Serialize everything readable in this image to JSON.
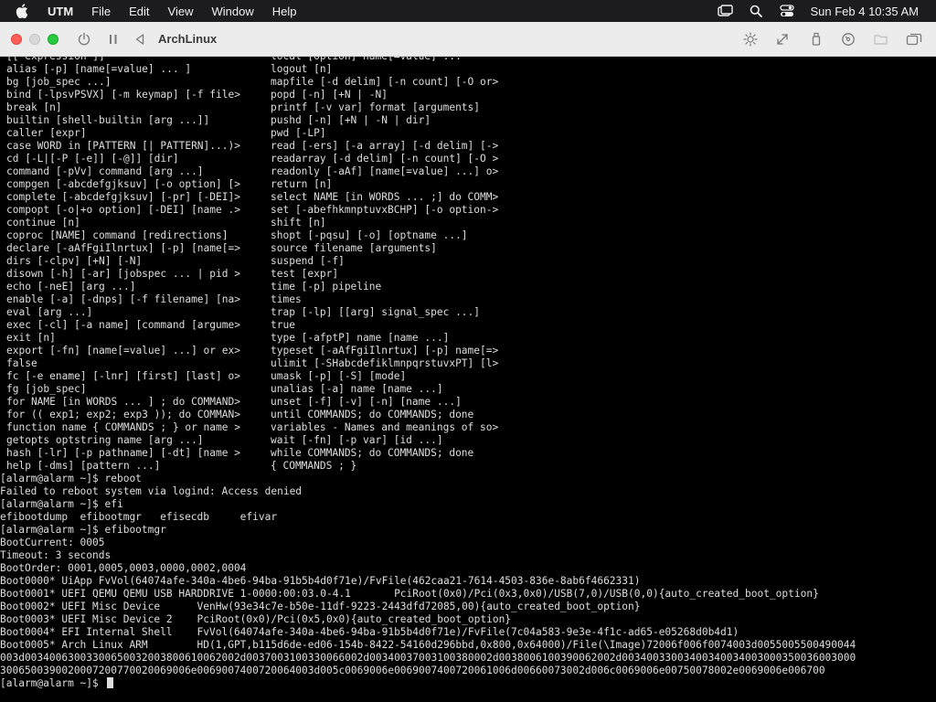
{
  "menubar": {
    "app_name": "UTM",
    "items": [
      "File",
      "Edit",
      "View",
      "Window",
      "Help"
    ],
    "clock": "Sun Feb 4  10:35 AM"
  },
  "window": {
    "title": "ArchLinux"
  },
  "terminal": {
    "help_left": [
      "[[ expression ]]",
      "alias [-p] [name[=value] ... ]",
      "bg [job_spec ...]",
      "bind [-lpsvPSVX] [-m keymap] [-f file>",
      "break [n]",
      "builtin [shell-builtin [arg ...]]",
      "caller [expr]",
      "case WORD in [PATTERN [| PATTERN]...)>",
      "cd [-L|[-P [-e]] [-@]] [dir]",
      "command [-pVv] command [arg ...]",
      "compgen [-abcdefgjksuv] [-o option] [>",
      "complete [-abcdefgjksuv] [-pr] [-DEI]>",
      "compopt [-o|+o option] [-DEI] [name .>",
      "continue [n]",
      "coproc [NAME] command [redirections]",
      "declare [-aAfFgiIlnrtux] [-p] [name[=>",
      "dirs [-clpv] [+N] [-N]",
      "disown [-h] [-ar] [jobspec ... | pid >",
      "echo [-neE] [arg ...]",
      "enable [-a] [-dnps] [-f filename] [na>",
      "eval [arg ...]",
      "exec [-cl] [-a name] [command [argume>",
      "exit [n]",
      "export [-fn] [name[=value] ...] or ex>",
      "false",
      "fc [-e ename] [-lnr] [first] [last] o>",
      "fg [job_spec]",
      "for NAME [in WORDS ... ] ; do COMMAND>",
      "for (( exp1; exp2; exp3 )); do COMMAN>",
      "function name { COMMANDS ; } or name >",
      "getopts optstring name [arg ...]",
      "hash [-lr] [-p pathname] [-dt] [name >",
      "help [-dms] [pattern ...]"
    ],
    "help_right": [
      "local [option] name[=value] ...",
      "logout [n]",
      "mapfile [-d delim] [-n count] [-O or>",
      "popd [-n] [+N | -N]",
      "printf [-v var] format [arguments]",
      "pushd [-n] [+N | -N | dir]",
      "pwd [-LP]",
      "read [-ers] [-a array] [-d delim] [->",
      "readarray [-d delim] [-n count] [-O >",
      "readonly [-aAf] [name[=value] ...] o>",
      "return [n]",
      "select NAME [in WORDS ... ;] do COMM>",
      "set [-abefhkmnptuvxBCHP] [-o option->",
      "shift [n]",
      "shopt [-pqsu] [-o] [optname ...]",
      "source filename [arguments]",
      "suspend [-f]",
      "test [expr]",
      "time [-p] pipeline",
      "times",
      "trap [-lp] [[arg] signal_spec ...]",
      "true",
      "type [-afptP] name [name ...]",
      "typeset [-aAfFgiIlnrtux] [-p] name[=>",
      "ulimit [-SHabcdefiklmnpqrstuvxPT] [l>",
      "umask [-p] [-S] [mode]",
      "unalias [-a] name [name ...]",
      "unset [-f] [-v] [-n] [name ...]",
      "until COMMANDS; do COMMANDS; done",
      "variables - Names and meanings of so>",
      "wait [-fn] [-p var] [id ...]",
      "while COMMANDS; do COMMANDS; done",
      "{ COMMANDS ; }"
    ],
    "output": [
      "[alarm@alarm ~]$ reboot",
      "Failed to reboot system via logind: Access denied",
      "[alarm@alarm ~]$ efi",
      "efibootdump  efibootmgr   efisecdb     efivar",
      "[alarm@alarm ~]$ efibootmgr",
      "BootCurrent: 0005",
      "Timeout: 3 seconds",
      "BootOrder: 0001,0005,0003,0000,0002,0004",
      "Boot0000* UiApp FvVol(64074afe-340a-4be6-94ba-91b5b4d0f71e)/FvFile(462caa21-7614-4503-836e-8ab6f4662331)",
      "Boot0001* UEFI QEMU QEMU USB HARDDRIVE 1-0000:00:03.0-4.1       PciRoot(0x0)/Pci(0x3,0x0)/USB(7,0)/USB(0,0){auto_created_boot_option}",
      "Boot0002* UEFI Misc Device      VenHw(93e34c7e-b50e-11df-9223-2443dfd72085,00){auto_created_boot_option}",
      "Boot0003* UEFI Misc Device 2    PciRoot(0x0)/Pci(0x5,0x0){auto_created_boot_option}",
      "Boot0004* EFI Internal Shell    FvVol(64074afe-340a-4be6-94ba-91b5b4d0f71e)/FvFile(7c04a583-9e3e-4f1c-ad65-e05268d0b4d1)",
      "Boot0005* Arch Linux ARM        HD(1,GPT,b115d6de-ed06-154b-8422-54160d296bbd,0x800,0x64000)/File(\\Image)72006f006f0074003d0055005500490044",
      "003d00340063003300650032003800610062002d0037003100330066002d00340037003100380002d0038006100390062002d00340033003400340034003000350036003000",
      "3006500390020007200770020069006e0069007400720064003d005c0069006e0069007400720061006d00660073002d006c0069006e00750078002e0069006e006700"
    ],
    "prompt": "[alarm@alarm ~]$ "
  },
  "colors": {
    "terminal_bg": "#000000",
    "terminal_fg": "#dedede",
    "menubar_bg": "#1c1c1e",
    "toolbar_bg": "#ececec"
  },
  "icons": {
    "menubar": [
      "apple-icon",
      "screen-mirroring-icon",
      "search-icon",
      "control-center-icon"
    ],
    "toolbar": [
      "power-icon",
      "pause-icon",
      "back-icon",
      "brightness-icon",
      "resize-icon",
      "usb-icon",
      "disc-icon",
      "folder-icon",
      "windows-icon"
    ]
  }
}
